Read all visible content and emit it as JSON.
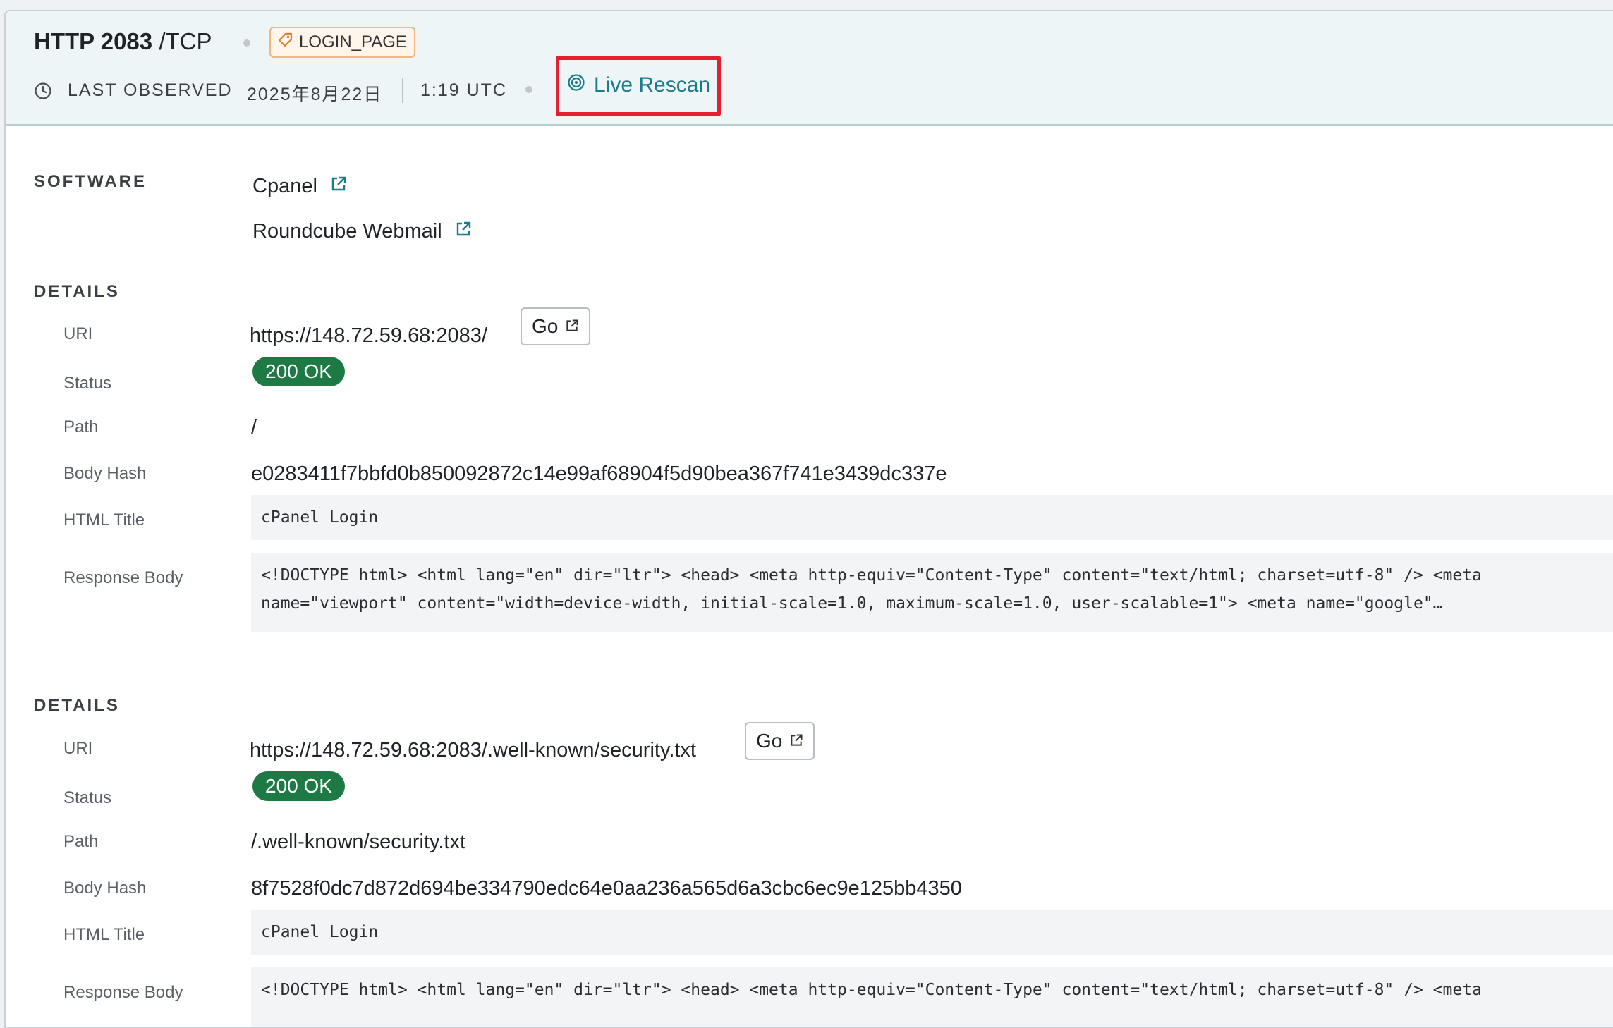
{
  "header": {
    "protocol_name": "HTTP 2083",
    "protocol_suffix": "/TCP",
    "tag_label": "LOGIN_PAGE",
    "last_observed_label": "LAST OBSERVED",
    "date": "2025年8月22日",
    "time": "1:19 UTC",
    "rescan_label": "Live Rescan"
  },
  "software": {
    "label": "SOFTWARE",
    "items": [
      "Cpanel",
      "Roundcube Webmail"
    ]
  },
  "details": [
    {
      "label": "DETAILS",
      "uri_label": "URI",
      "uri": "https://148.72.59.68:2083/",
      "go_label": "Go",
      "status_label": "Status",
      "status": "200 OK",
      "path_label": "Path",
      "path": "/",
      "hash_label": "Body Hash",
      "hash": "e0283411f7bbfd0b850092872c14e99af68904f5d90bea367f741e3439dc337e",
      "title_label": "HTML Title",
      "title": "cPanel Login",
      "body_label": "Response Body",
      "body_line1": "<!DOCTYPE html> <html lang=\"en\" dir=\"ltr\"> <head> <meta http-equiv=\"Content-Type\" content=\"text/html; charset=utf-8\" /> <meta",
      "body_line2": "name=\"viewport\" content=\"width=device-width, initial-scale=1.0, maximum-scale=1.0, user-scalable=1\"> <meta name=\"google\"…"
    },
    {
      "label": "DETAILS",
      "uri_label": "URI",
      "uri": "https://148.72.59.68:2083/.well-known/security.txt",
      "go_label": "Go",
      "status_label": "Status",
      "status": "200 OK",
      "path_label": "Path",
      "path": "/.well-known/security.txt",
      "hash_label": "Body Hash",
      "hash": "8f7528f0dc7d872d694be334790edc64e0aa236a565d6a3cbc6ec9e125bb4350",
      "title_label": "HTML Title",
      "title": "cPanel Login",
      "body_label": "Response Body",
      "body_line1": "<!DOCTYPE html> <html lang=\"en\" dir=\"ltr\"> <head> <meta http-equiv=\"Content-Type\" content=\"text/html; charset=utf-8\" /> <meta"
    }
  ],
  "colors": {
    "accent": "#1b7a8c",
    "status_green": "#1e7a44",
    "highlight_red": "#e3202e",
    "tag_orange": "#f0b77e"
  },
  "icons": [
    "clock-icon",
    "tag-icon",
    "rescan-icon",
    "external-link-icon"
  ]
}
